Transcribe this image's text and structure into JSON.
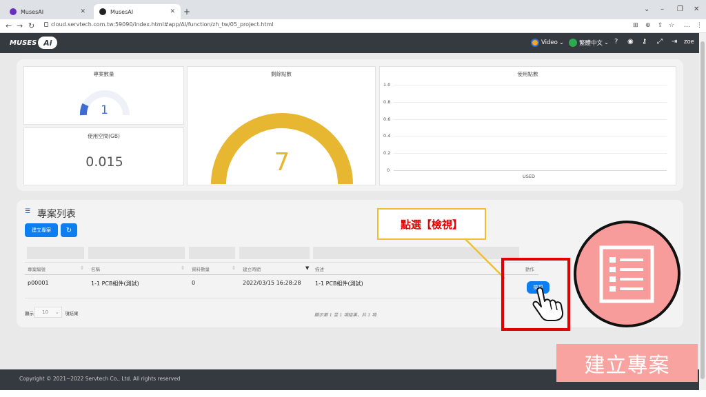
{
  "browser": {
    "tabs": [
      {
        "title": "MusesAI"
      },
      {
        "title": "MusesAI"
      }
    ],
    "url": "cloud.servtech.com.tw:59090/index.html#app/AI/function/zh_tw/05_project.html",
    "user": "zoe"
  },
  "header": {
    "video_label": "Video",
    "language_label": "繁體中文",
    "logo_text": "MUSES",
    "logo_ai": "Ai"
  },
  "stats": {
    "project_count_title": "專案數量",
    "project_count": "1",
    "space_title": "使用空間(GB)",
    "space_value": "0.015",
    "points_title": "剩餘點數",
    "points_value": "7",
    "used_title": "使用點數"
  },
  "chart_data": {
    "type": "bar",
    "title": "使用點數",
    "categories": [
      "USED"
    ],
    "values": [
      0
    ],
    "ylim": [
      0,
      1.0
    ],
    "yticks": [
      "1.0",
      "0.8",
      "0.6",
      "0.4",
      "0.2",
      "0"
    ],
    "grid": true
  },
  "project_list": {
    "title": "專案列表",
    "create_button": "建立專案",
    "columns": [
      "專案編號",
      "名稱",
      "資料數量",
      "建立時間",
      "描述",
      "動作"
    ],
    "rows": [
      {
        "id": "p00001",
        "name": "1-1 PCB組件(測試)",
        "count": "0",
        "created": "2022/03/15 16:28:28",
        "desc": "1-1 PCB組件(測試)",
        "action": "檢視"
      }
    ],
    "show_label": "顯示",
    "page_size": "10",
    "items_label": "項結果",
    "summary": "顯示第 1 至 1 項結果，共 1 項"
  },
  "annotations": {
    "callout": "點選【檢視】",
    "section_label": "建立專案"
  },
  "footer": {
    "copyright": "Copyright © 2021~2022 Servtech Co., Ltd. All rights reserved"
  },
  "colors": {
    "header_bg": "#343a40",
    "gauge_gold": "#e8b732",
    "gauge_blue": "#3f6cd0",
    "accent_blue": "#0d7ef0",
    "annotation_red": "#e50000",
    "annotation_pink": "#f9a3a1"
  }
}
